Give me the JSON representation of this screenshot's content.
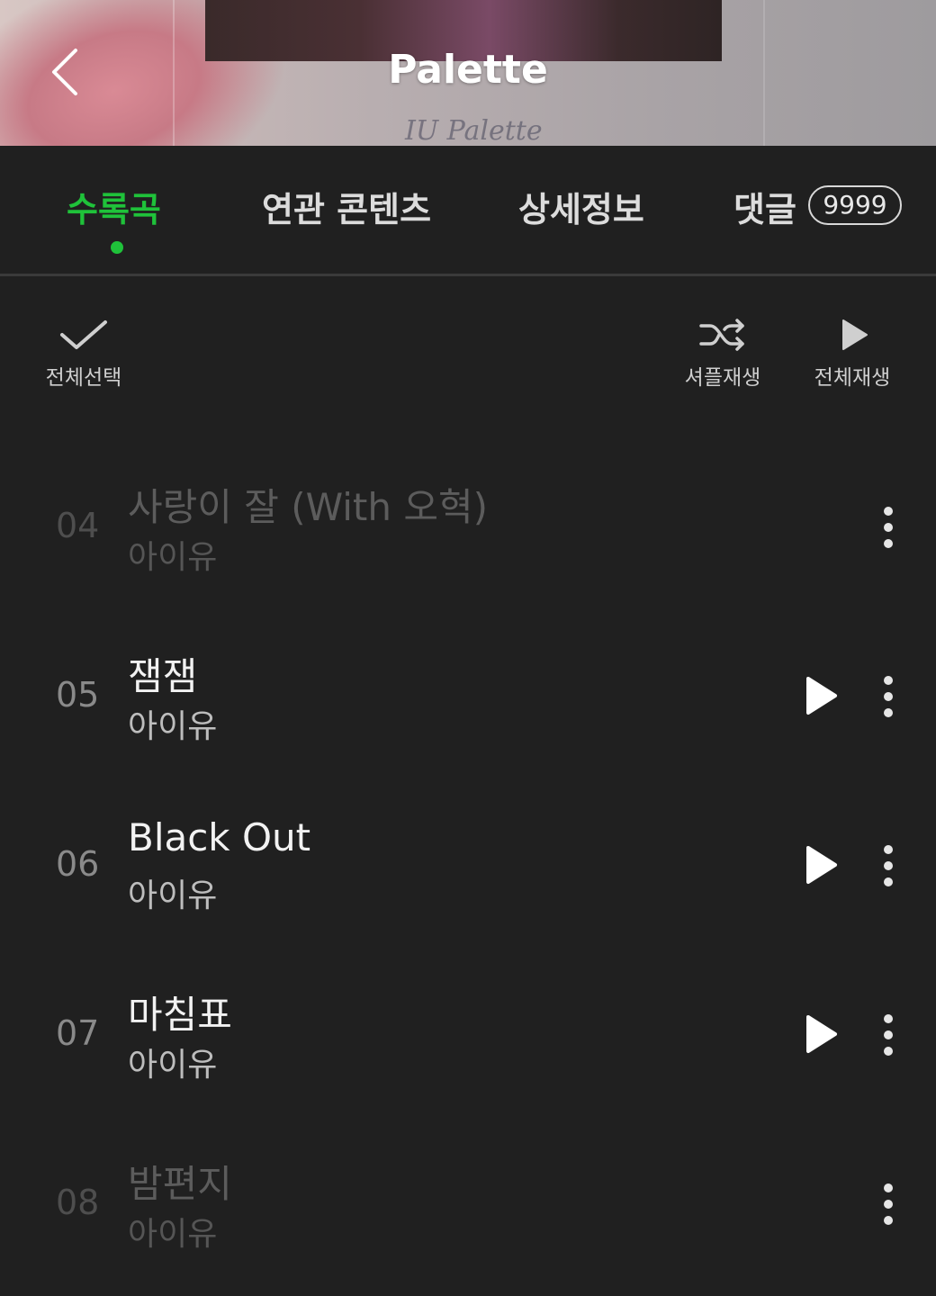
{
  "header": {
    "title": "Palette",
    "album_script": "IU Palette",
    "back_icon": "chevron-left-icon"
  },
  "tabs": [
    {
      "label": "수록곡",
      "active": true
    },
    {
      "label": "연관 콘텐츠",
      "active": false
    },
    {
      "label": "상세정보",
      "active": false
    },
    {
      "label": "댓글",
      "active": false,
      "badge": "9999"
    }
  ],
  "actions": {
    "select_all": {
      "label": "전체선택",
      "icon": "check-icon"
    },
    "shuffle": {
      "label": "셔플재생",
      "icon": "shuffle-icon"
    },
    "play_all": {
      "label": "전체재생",
      "icon": "play-icon"
    }
  },
  "tracks": [
    {
      "number": "04",
      "title": "사랑이 잘 (With 오혁)",
      "artist": "아이유",
      "playable": false
    },
    {
      "number": "05",
      "title": "잼잼",
      "artist": "아이유",
      "playable": true
    },
    {
      "number": "06",
      "title": "Black Out",
      "artist": "아이유",
      "playable": true
    },
    {
      "number": "07",
      "title": "마침표",
      "artist": "아이유",
      "playable": true
    },
    {
      "number": "08",
      "title": "밤편지",
      "artist": "아이유",
      "playable": false
    }
  ],
  "colors": {
    "accent": "#1fc23a",
    "background": "#202020",
    "text_primary": "#f2f2f2",
    "text_dimmed": "#5c5c5c"
  }
}
